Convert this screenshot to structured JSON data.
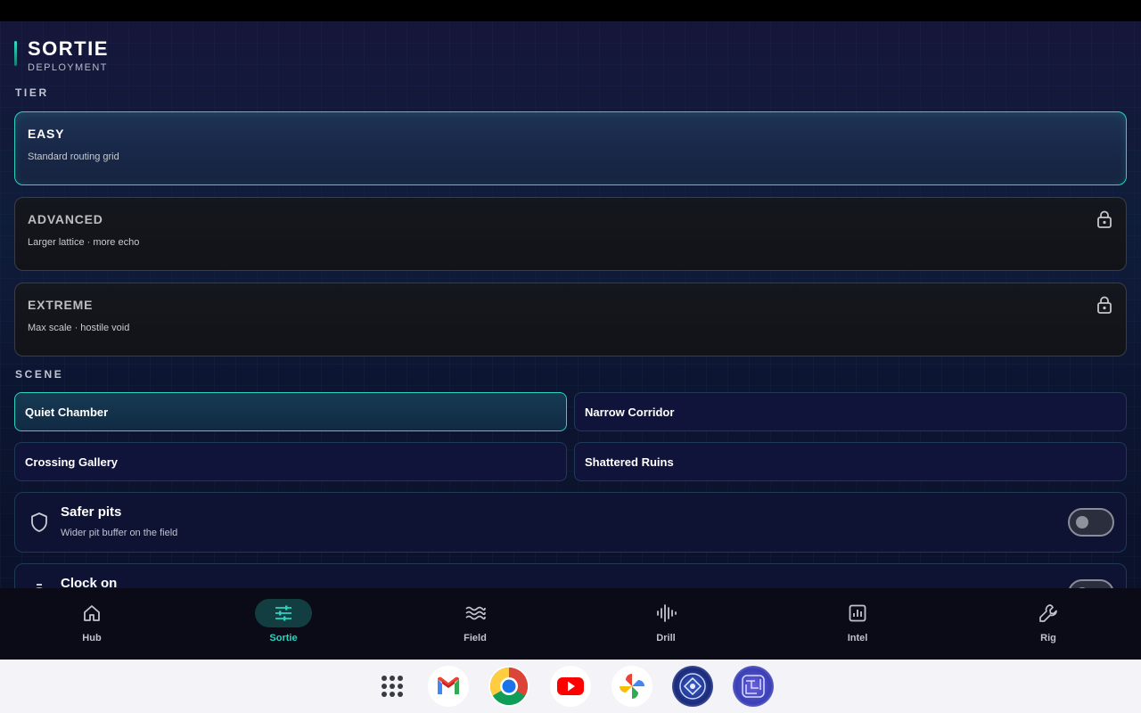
{
  "header": {
    "title": "SORTIE",
    "subtitle": "DEPLOYMENT"
  },
  "tier": {
    "label": "TIER",
    "options": [
      {
        "name": "EASY",
        "desc": "Standard routing grid",
        "selected": true,
        "locked": false
      },
      {
        "name": "ADVANCED",
        "desc": "Larger lattice · more echo",
        "selected": false,
        "locked": true
      },
      {
        "name": "EXTREME",
        "desc": "Max scale · hostile void",
        "selected": false,
        "locked": true
      }
    ]
  },
  "scene": {
    "label": "SCENE",
    "options": [
      {
        "name": "Quiet Chamber",
        "selected": true
      },
      {
        "name": "Narrow Corridor",
        "selected": false
      },
      {
        "name": "Crossing Gallery",
        "selected": false
      },
      {
        "name": "Shattered Ruins",
        "selected": false
      }
    ]
  },
  "toggles": [
    {
      "title": "Safer pits",
      "desc": "Wider pit buffer on the field",
      "icon": "shield-icon",
      "on": false
    },
    {
      "title": "Clock on",
      "desc": "",
      "icon": "timer-icon",
      "on": false
    }
  ],
  "nav": {
    "items": [
      {
        "label": "Hub",
        "icon": "home-icon",
        "active": false
      },
      {
        "label": "Sortie",
        "icon": "sliders-icon",
        "active": true
      },
      {
        "label": "Field",
        "icon": "waves-icon",
        "active": false
      },
      {
        "label": "Drill",
        "icon": "audio-wave-icon",
        "active": false
      },
      {
        "label": "Intel",
        "icon": "chart-icon",
        "active": false
      },
      {
        "label": "Rig",
        "icon": "wrench-icon",
        "active": false
      }
    ]
  },
  "dock": {
    "items": [
      "app-drawer-icon",
      "gmail-icon",
      "chrome-icon",
      "youtube-icon",
      "photos-icon",
      "game-app-icon",
      "maze-app-icon"
    ]
  },
  "colors": {
    "accent": "#2ad4c0",
    "background": "#0f1d3a",
    "card_locked": "#121419"
  }
}
